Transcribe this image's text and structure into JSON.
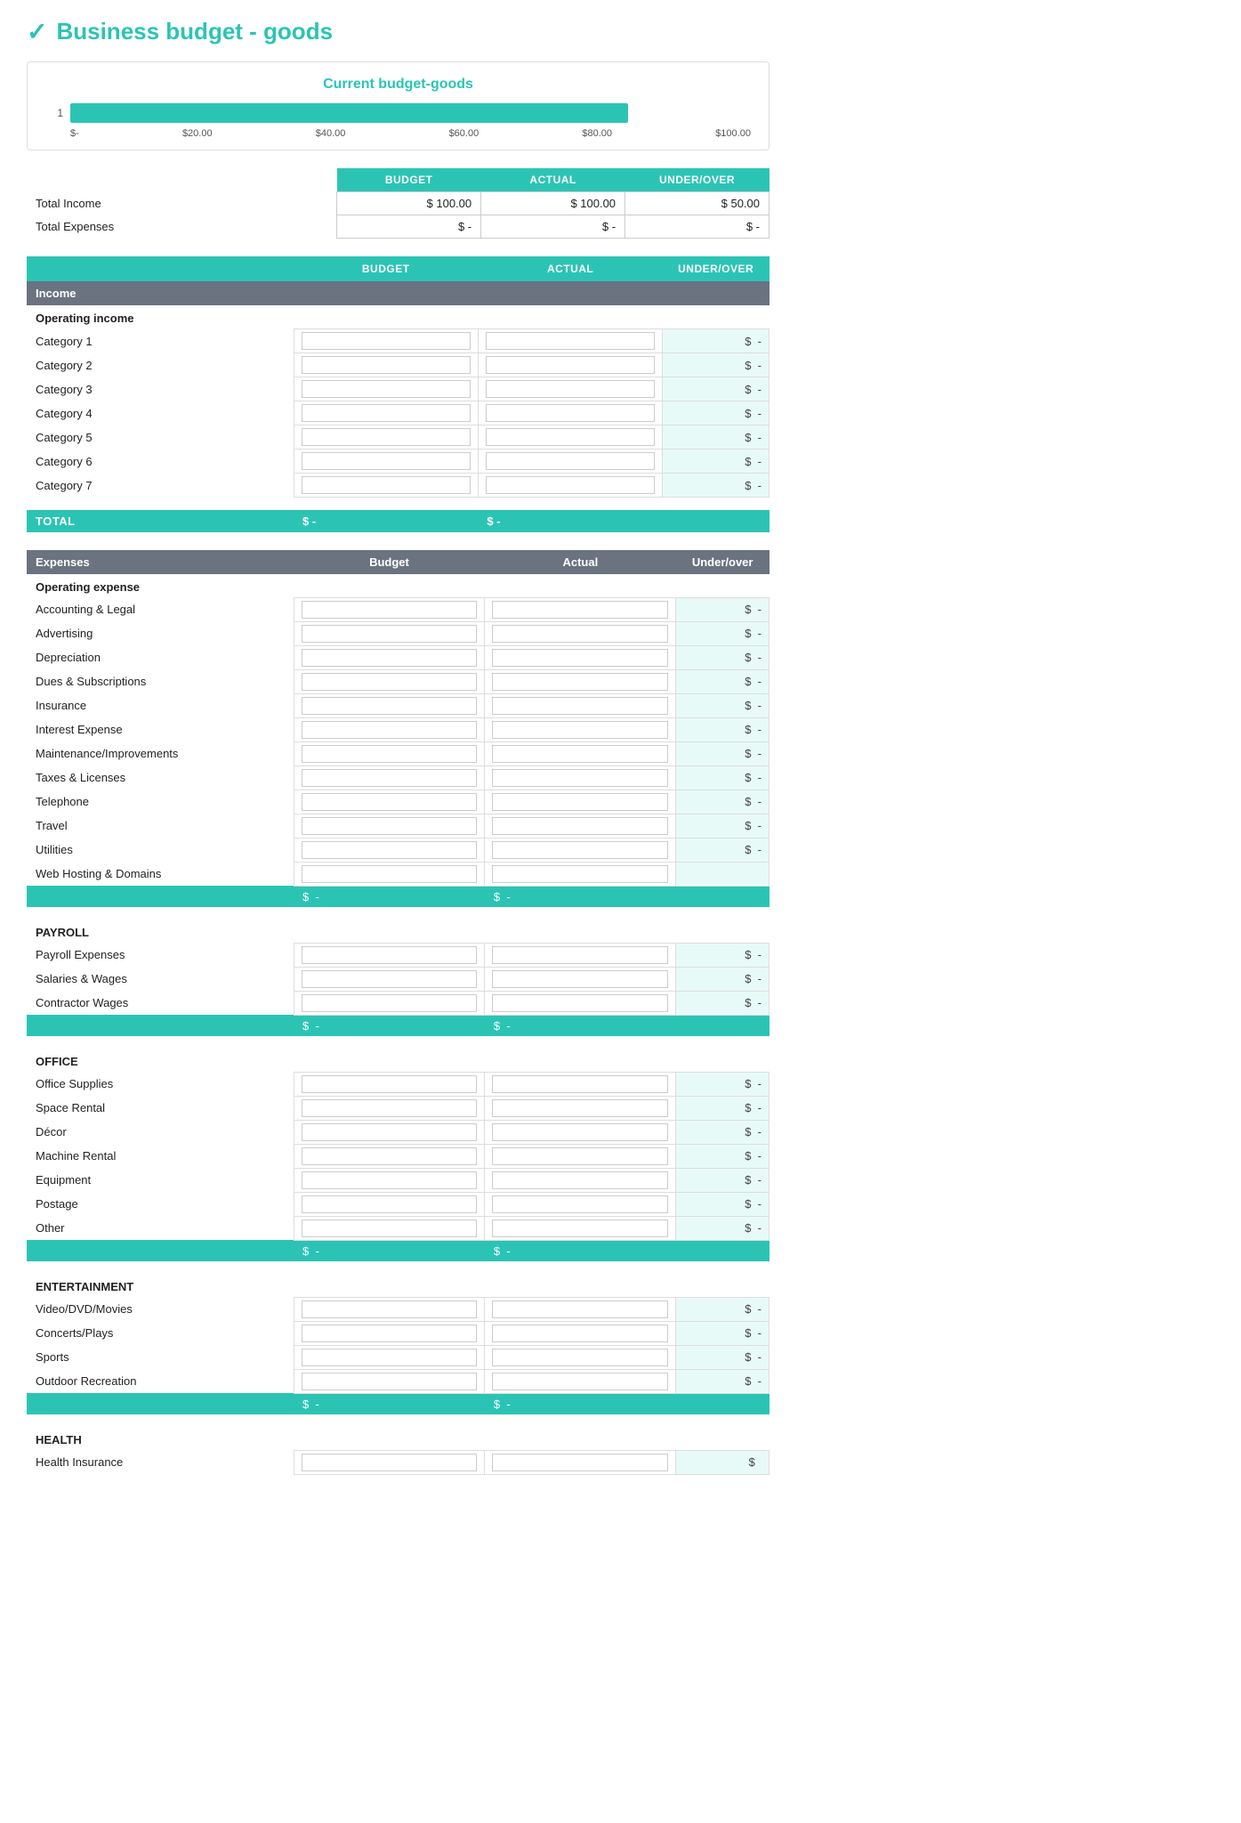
{
  "header": {
    "logo": "✓",
    "title": "Business budget - goods"
  },
  "chart": {
    "title": "Current budget-goods",
    "y_label": "1",
    "bar_width_pct": "82%",
    "axis_labels": [
      "$-",
      "$20.00",
      "$40.00",
      "$60.00",
      "$80.00",
      "$100.00"
    ]
  },
  "summary": {
    "columns": [
      "BUDGET",
      "ACTUAL",
      "UNDER/OVER"
    ],
    "rows": [
      {
        "label": "Total Income",
        "budget": "$ 100.00",
        "actual": "$ 100.00",
        "underover": "$ 50.00"
      },
      {
        "label": "Total Expenses",
        "budget": "$  -",
        "actual": "$  -",
        "underover": "$  -"
      }
    ]
  },
  "income_section": {
    "columns": [
      "",
      "BUDGET",
      "ACTUAL",
      "UNDER/OVER"
    ],
    "header": "Income",
    "subsection": "Operating income",
    "categories": [
      "Category 1",
      "Category 2",
      "Category 3",
      "Category 4",
      "Category 5",
      "Category 6",
      "Category 7"
    ],
    "total_label": "TOTAL",
    "total_budget": "$  -",
    "total_actual": "$  -"
  },
  "expenses_section": {
    "header": "Expenses",
    "columns": [
      "",
      "Budget",
      "Actual",
      "Under/over"
    ],
    "operating": {
      "subsection": "Operating expense",
      "items": [
        "Accounting & Legal",
        "Advertising",
        "Depreciation",
        "Dues & Subscriptions",
        "Insurance",
        "Interest Expense",
        "Maintenance/Improvements",
        "Taxes & Licenses",
        "Telephone",
        "Travel",
        "Utilities",
        "Web Hosting & Domains"
      ]
    },
    "payroll": {
      "subsection": "PAYROLL",
      "items": [
        "Payroll Expenses",
        "Salaries & Wages",
        "Contractor Wages"
      ]
    },
    "office": {
      "subsection": "OFFICE",
      "items": [
        "Office Supplies",
        "Space Rental",
        "Décor",
        "Machine Rental",
        "Equipment",
        "Postage",
        "Other"
      ]
    },
    "entertainment": {
      "subsection": "ENTERTAINMENT",
      "items": [
        "Video/DVD/Movies",
        "Concerts/Plays",
        "Sports",
        "Outdoor Recreation"
      ]
    },
    "health": {
      "subsection": "HEALTH",
      "items": [
        "Health Insurance"
      ]
    },
    "dollar_dash": "$  -"
  },
  "colors": {
    "teal": "#2bc4b4",
    "gray_header": "#6b7280",
    "light_bg": "#e8faf8"
  }
}
